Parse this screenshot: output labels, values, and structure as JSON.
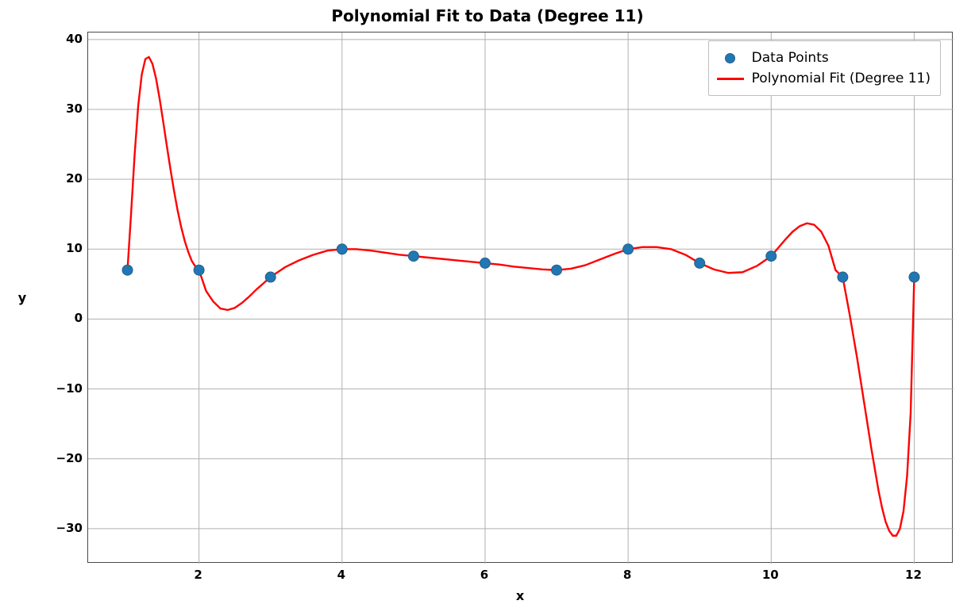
{
  "chart_data": {
    "type": "line+scatter",
    "title": "Polynomial Fit to Data (Degree 11)",
    "xlabel": "x",
    "ylabel": "y",
    "xlim": [
      0.45,
      12.55
    ],
    "ylim": [
      -35,
      41
    ],
    "xticks": [
      2,
      4,
      6,
      8,
      10,
      12
    ],
    "yticks": [
      -30,
      -20,
      -10,
      0,
      10,
      20,
      30,
      40
    ],
    "grid": true,
    "legend_position": "upper right",
    "series": [
      {
        "name": "Data Points",
        "type": "scatter",
        "color": "#1f77b4",
        "x": [
          1,
          2,
          3,
          4,
          5,
          6,
          7,
          8,
          9,
          10,
          11,
          12
        ],
        "y": [
          7,
          7,
          6,
          10,
          9,
          8,
          7,
          10,
          8,
          9,
          6,
          6
        ]
      },
      {
        "name": "Polynomial Fit (Degree 11)",
        "type": "line",
        "color": "#ff0000",
        "linewidth": 2.4,
        "x": [
          1.0,
          1.05,
          1.1,
          1.15,
          1.2,
          1.25,
          1.3,
          1.35,
          1.4,
          1.45,
          1.5,
          1.55,
          1.6,
          1.65,
          1.7,
          1.75,
          1.8,
          1.85,
          1.9,
          1.95,
          2.0,
          2.1,
          2.2,
          2.3,
          2.4,
          2.5,
          2.6,
          2.7,
          2.8,
          2.9,
          3.0,
          3.2,
          3.4,
          3.6,
          3.8,
          4.0,
          4.2,
          4.4,
          4.6,
          4.8,
          5.0,
          5.2,
          5.4,
          5.6,
          5.8,
          6.0,
          6.2,
          6.4,
          6.6,
          6.8,
          7.0,
          7.2,
          7.4,
          7.6,
          7.8,
          8.0,
          8.2,
          8.4,
          8.6,
          8.8,
          9.0,
          9.2,
          9.4,
          9.6,
          9.8,
          10.0,
          10.1,
          10.2,
          10.3,
          10.4,
          10.5,
          10.6,
          10.7,
          10.8,
          10.9,
          11.0,
          11.1,
          11.2,
          11.3,
          11.4,
          11.5,
          11.55,
          11.6,
          11.65,
          11.7,
          11.75,
          11.8,
          11.85,
          11.9,
          11.95,
          12.0
        ],
        "y": [
          7.0,
          15.0,
          23.5,
          30.5,
          35.0,
          37.2,
          37.5,
          36.5,
          34.4,
          31.5,
          28.2,
          24.8,
          21.5,
          18.4,
          15.6,
          13.2,
          11.2,
          9.6,
          8.3,
          7.5,
          7.0,
          4.0,
          2.5,
          1.5,
          1.3,
          1.6,
          2.3,
          3.2,
          4.2,
          5.1,
          6.0,
          7.4,
          8.4,
          9.2,
          9.8,
          10.0,
          10.0,
          9.8,
          9.5,
          9.2,
          9.0,
          8.8,
          8.6,
          8.4,
          8.2,
          8.0,
          7.8,
          7.5,
          7.3,
          7.1,
          7.0,
          7.2,
          7.7,
          8.5,
          9.3,
          10.0,
          10.3,
          10.3,
          10.0,
          9.2,
          8.0,
          7.1,
          6.6,
          6.7,
          7.6,
          9.0,
          10.2,
          11.4,
          12.5,
          13.3,
          13.7,
          13.5,
          12.5,
          10.5,
          7.0,
          6.0,
          0.5,
          -5.5,
          -12.0,
          -18.5,
          -24.5,
          -27.0,
          -29.0,
          -30.3,
          -31.0,
          -31.0,
          -30.0,
          -27.5,
          -22.5,
          -13.5,
          6.0
        ]
      }
    ]
  },
  "legend": {
    "items": [
      {
        "label": "Data Points"
      },
      {
        "label": "Polynomial Fit (Degree 11)"
      }
    ]
  },
  "xtick_labels": [
    "2",
    "4",
    "6",
    "8",
    "10",
    "12"
  ],
  "ytick_labels": [
    "−30",
    "−20",
    "−10",
    "0",
    "10",
    "20",
    "30",
    "40"
  ]
}
